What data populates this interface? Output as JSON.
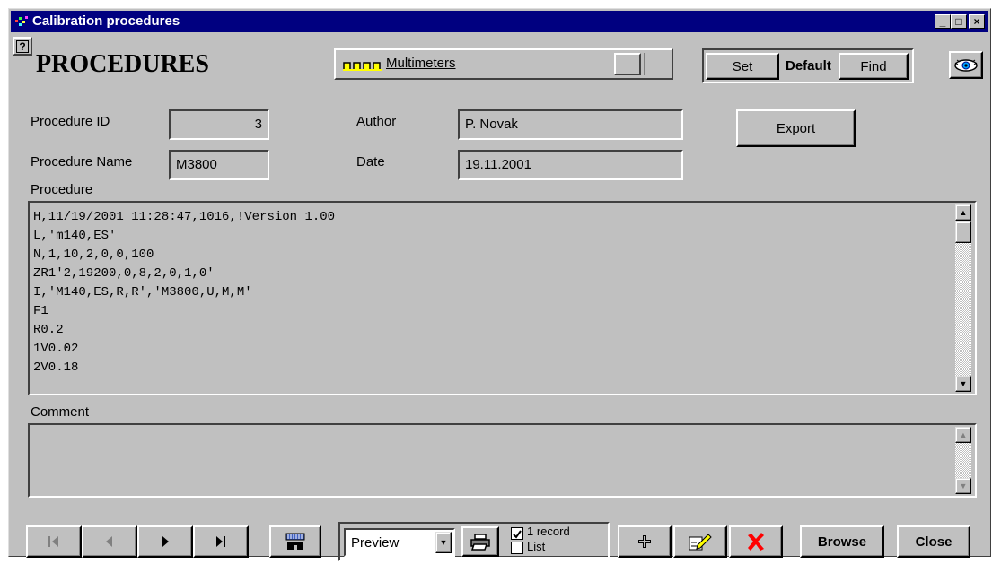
{
  "window": {
    "title": "Calibration procedures",
    "controls": {
      "minimize": "_",
      "maximize": "□",
      "close": "×"
    }
  },
  "header": {
    "help_icon": "?",
    "page_title": "PROCEDURES",
    "category_label": "Multimeters",
    "set_label": "Set",
    "default_label": "Default",
    "find_label": "Find"
  },
  "form": {
    "procedure_id_label": "Procedure ID",
    "procedure_id_value": "3",
    "procedure_name_label": "Procedure Name",
    "procedure_name_value": "M3800",
    "author_label": "Author",
    "author_value": "P. Novak",
    "date_label": "Date",
    "date_value": "19.11.2001",
    "export_label": "Export",
    "procedure_label": "Procedure",
    "procedure_lines": [
      "H,11/19/2001 11:28:47,1016,!Version 1.00",
      "L,'m140,ES'",
      "N,1,10,2,0,0,100",
      "ZR1'2,19200,0,8,2,0,1,0'",
      "I,'M140,ES,R,R','M3800,U,M,M'",
      "F1",
      "R0.2",
      "1V0.02",
      "2V0.18"
    ],
    "comment_label": "Comment",
    "comment_value": ""
  },
  "toolbar": {
    "output_select_value": "Preview",
    "record_checkbox_label": "1 record",
    "list_checkbox_label": "List",
    "record_checked": true,
    "list_checked": false,
    "browse_label": "Browse",
    "close_label": "Close"
  },
  "icons": {
    "nav_first": "first-record-icon",
    "nav_prev": "previous-record-icon",
    "nav_next": "next-record-icon",
    "nav_last": "last-record-icon",
    "search": "binoculars-icon",
    "print": "printer-icon",
    "add": "plus-icon",
    "edit": "edit-icon",
    "delete": "delete-x-icon",
    "view": "eye-icon"
  },
  "colors": {
    "titlebar": "#000080",
    "face": "#c0c0c0",
    "delete_red": "#ff0000",
    "category_icon": "#ffff00"
  }
}
